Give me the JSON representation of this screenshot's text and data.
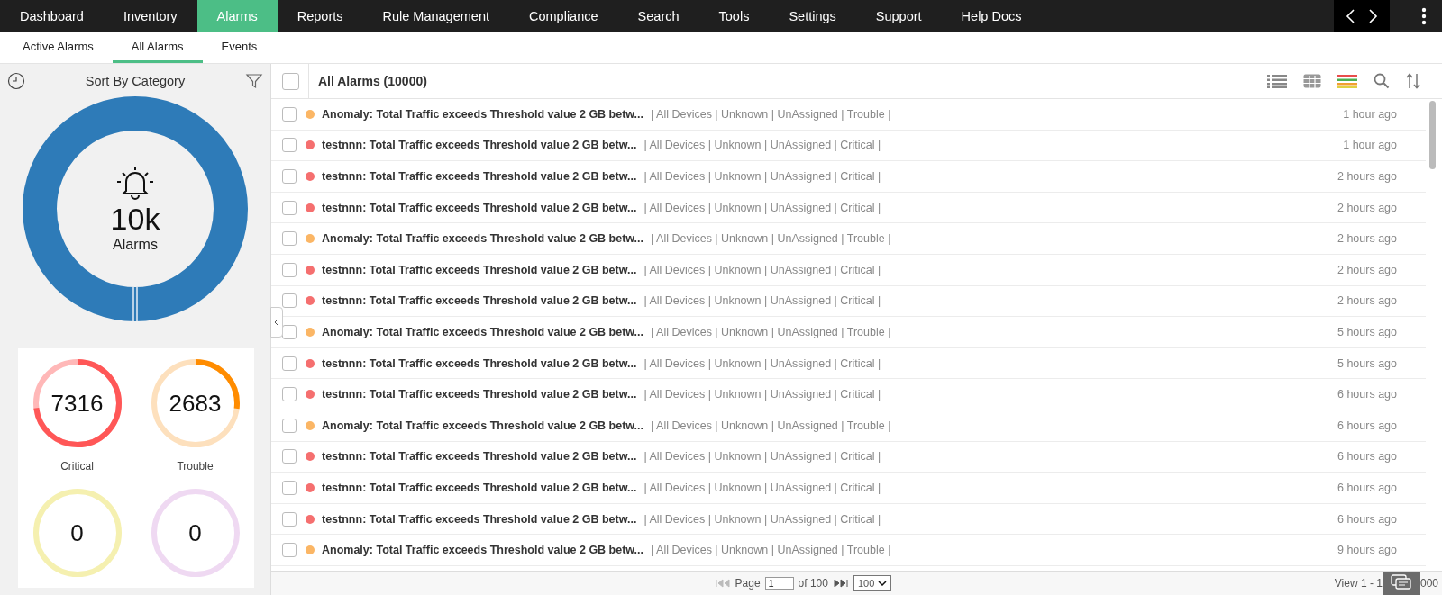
{
  "top_nav": [
    {
      "label": "Dashboard",
      "selected": false
    },
    {
      "label": "Inventory",
      "selected": false
    },
    {
      "label": "Alarms",
      "selected": true
    },
    {
      "label": "Reports",
      "selected": false
    },
    {
      "label": "Rule Management",
      "selected": false
    },
    {
      "label": "Compliance",
      "selected": false
    },
    {
      "label": "Search",
      "selected": false
    },
    {
      "label": "Tools",
      "selected": false
    },
    {
      "label": "Settings",
      "selected": false
    },
    {
      "label": "Support",
      "selected": false
    },
    {
      "label": "Help Docs",
      "selected": false
    }
  ],
  "sub_nav": [
    {
      "label": "Active Alarms",
      "selected": false
    },
    {
      "label": "All Alarms",
      "selected": true
    },
    {
      "label": "Events",
      "selected": false
    }
  ],
  "sidebar": {
    "title": "Sort By Category",
    "total": "10k",
    "total_label": "Alarms",
    "categories": [
      {
        "count": "7316",
        "label": "Critical",
        "color": "#ffb8b8",
        "level": 0.73
      },
      {
        "count": "2683",
        "label": "Trouble",
        "color": "#fde0bd",
        "level": 0.27
      },
      {
        "count": "0",
        "color": "#f5f0b0"
      },
      {
        "count": "0",
        "color": "#efd9f2"
      }
    ]
  },
  "list": {
    "title": "All Alarms (10000)",
    "select_all": false,
    "rows": [
      {
        "title": "Anomaly: Total Traffic exceeds Threshold value 2 GB betw...",
        "meta": "| All Devices | Unknown | UnAssigned | Trouble |",
        "time": "1 hour ago",
        "color": "#fbb665",
        "checked": false
      },
      {
        "title": "testnnn: Total Traffic exceeds Threshold value 2 GB betw...",
        "meta": "| All Devices | Unknown | UnAssigned | Critical |",
        "time": "1 hour ago",
        "color": "#f56f6f",
        "checked": false
      },
      {
        "title": "testnnn: Total Traffic exceeds Threshold value 2 GB betw...",
        "meta": "| All Devices | Unknown | UnAssigned | Critical |",
        "time": "2 hours ago",
        "color": "#f56f6f",
        "checked": false
      },
      {
        "title": "testnnn: Total Traffic exceeds Threshold value 2 GB betw...",
        "meta": "| All Devices | Unknown | UnAssigned | Critical |",
        "time": "2 hours ago",
        "color": "#f56f6f",
        "checked": false
      },
      {
        "title": "Anomaly: Total Traffic exceeds Threshold value 2 GB betw...",
        "meta": "| All Devices | Unknown | UnAssigned | Trouble |",
        "time": "2 hours ago",
        "color": "#fbb665",
        "checked": false
      },
      {
        "title": "testnnn: Total Traffic exceeds Threshold value 2 GB betw...",
        "meta": "| All Devices | Unknown | UnAssigned | Critical |",
        "time": "2 hours ago",
        "color": "#f56f6f",
        "checked": false
      },
      {
        "title": "testnnn: Total Traffic exceeds Threshold value 2 GB betw...",
        "meta": "| All Devices | Unknown | UnAssigned | Critical |",
        "time": "2 hours ago",
        "color": "#f56f6f",
        "checked": false
      },
      {
        "title": "Anomaly: Total Traffic exceeds Threshold value 2 GB betw...",
        "meta": "| All Devices | Unknown | UnAssigned | Trouble |",
        "time": "5 hours ago",
        "color": "#fbb665",
        "checked": false
      },
      {
        "title": "testnnn: Total Traffic exceeds Threshold value 2 GB betw...",
        "meta": "| All Devices | Unknown | UnAssigned | Critical |",
        "time": "5 hours ago",
        "color": "#f56f6f",
        "checked": false
      },
      {
        "title": "testnnn: Total Traffic exceeds Threshold value 2 GB betw...",
        "meta": "| All Devices | Unknown | UnAssigned | Critical |",
        "time": "6 hours ago",
        "color": "#f56f6f",
        "checked": false
      },
      {
        "title": "Anomaly: Total Traffic exceeds Threshold value 2 GB betw...",
        "meta": "| All Devices | Unknown | UnAssigned | Trouble |",
        "time": "6 hours ago",
        "color": "#fbb665",
        "checked": false
      },
      {
        "title": "testnnn: Total Traffic exceeds Threshold value 2 GB betw...",
        "meta": "| All Devices | Unknown | UnAssigned | Critical |",
        "time": "6 hours ago",
        "color": "#f56f6f",
        "checked": false
      },
      {
        "title": "testnnn: Total Traffic exceeds Threshold value 2 GB betw...",
        "meta": "| All Devices | Unknown | UnAssigned | Critical |",
        "time": "6 hours ago",
        "color": "#f56f6f",
        "checked": false
      },
      {
        "title": "testnnn: Total Traffic exceeds Threshold value 2 GB betw...",
        "meta": "| All Devices | Unknown | UnAssigned | Critical |",
        "time": "6 hours ago",
        "color": "#f56f6f",
        "checked": false
      },
      {
        "title": "Anomaly: Total Traffic exceeds Threshold value 2 GB betw...",
        "meta": "| All Devices | Unknown | UnAssigned | Trouble |",
        "time": "9 hours ago",
        "color": "#fbb665",
        "checked": false
      }
    ]
  },
  "pager": {
    "page_label": "Page",
    "page": "1",
    "of_label": "of 100",
    "page_size": "100",
    "view_start": "View 1 - 1",
    "view_end": "000"
  }
}
